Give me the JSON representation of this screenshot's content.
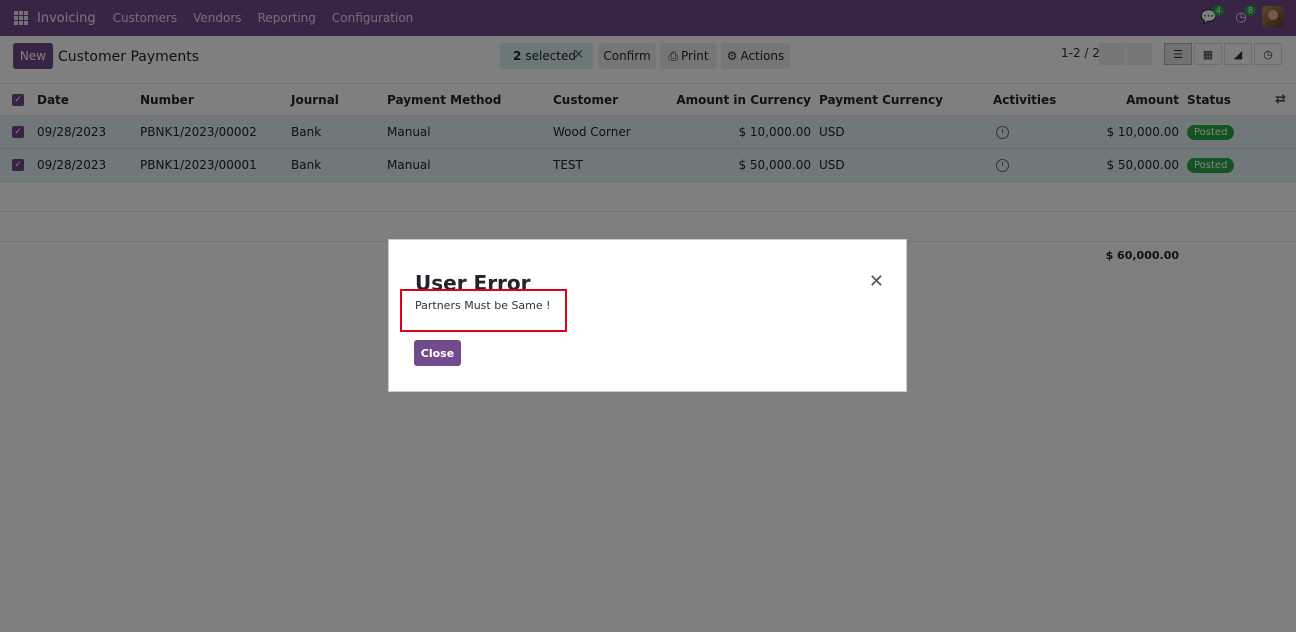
{
  "navbar": {
    "brand": "Invoicing",
    "menu": [
      "Customers",
      "Vendors",
      "Reporting",
      "Configuration"
    ],
    "chat_badge": "4",
    "activity_badge": "8"
  },
  "control_panel": {
    "new_label": "New",
    "title": "Customer Payments",
    "selected_count": "2",
    "selected_label": "selected",
    "confirm_label": "Confirm",
    "print_label": "Print",
    "actions_label": "Actions",
    "pager": "1-2 / 2"
  },
  "table": {
    "headers": {
      "date": "Date",
      "number": "Number",
      "journal": "Journal",
      "payment_method": "Payment Method",
      "customer": "Customer",
      "amount_currency": "Amount in Currency",
      "payment_currency": "Payment Currency",
      "activities": "Activities",
      "amount": "Amount",
      "status": "Status"
    },
    "rows": [
      {
        "date": "09/28/2023",
        "number": "PBNK1/2023/00002",
        "journal": "Bank",
        "method": "Manual",
        "customer": "Wood Corner",
        "amount_currency": "$ 10,000.00",
        "currency": "USD",
        "amount": "$ 10,000.00",
        "status": "Posted"
      },
      {
        "date": "09/28/2023",
        "number": "PBNK1/2023/00001",
        "journal": "Bank",
        "method": "Manual",
        "customer": "TEST",
        "amount_currency": "$ 50,000.00",
        "currency": "USD",
        "amount": "$ 50,000.00",
        "status": "Posted"
      }
    ],
    "total": "$ 60,000.00"
  },
  "dialog": {
    "title": "User Error",
    "message": "Partners Must be Same !",
    "close_label": "Close"
  },
  "colors": {
    "brand": "#714b8c",
    "selected_row": "#e1f0f2",
    "posted": "#28a745",
    "highlight": "#e0001b"
  }
}
